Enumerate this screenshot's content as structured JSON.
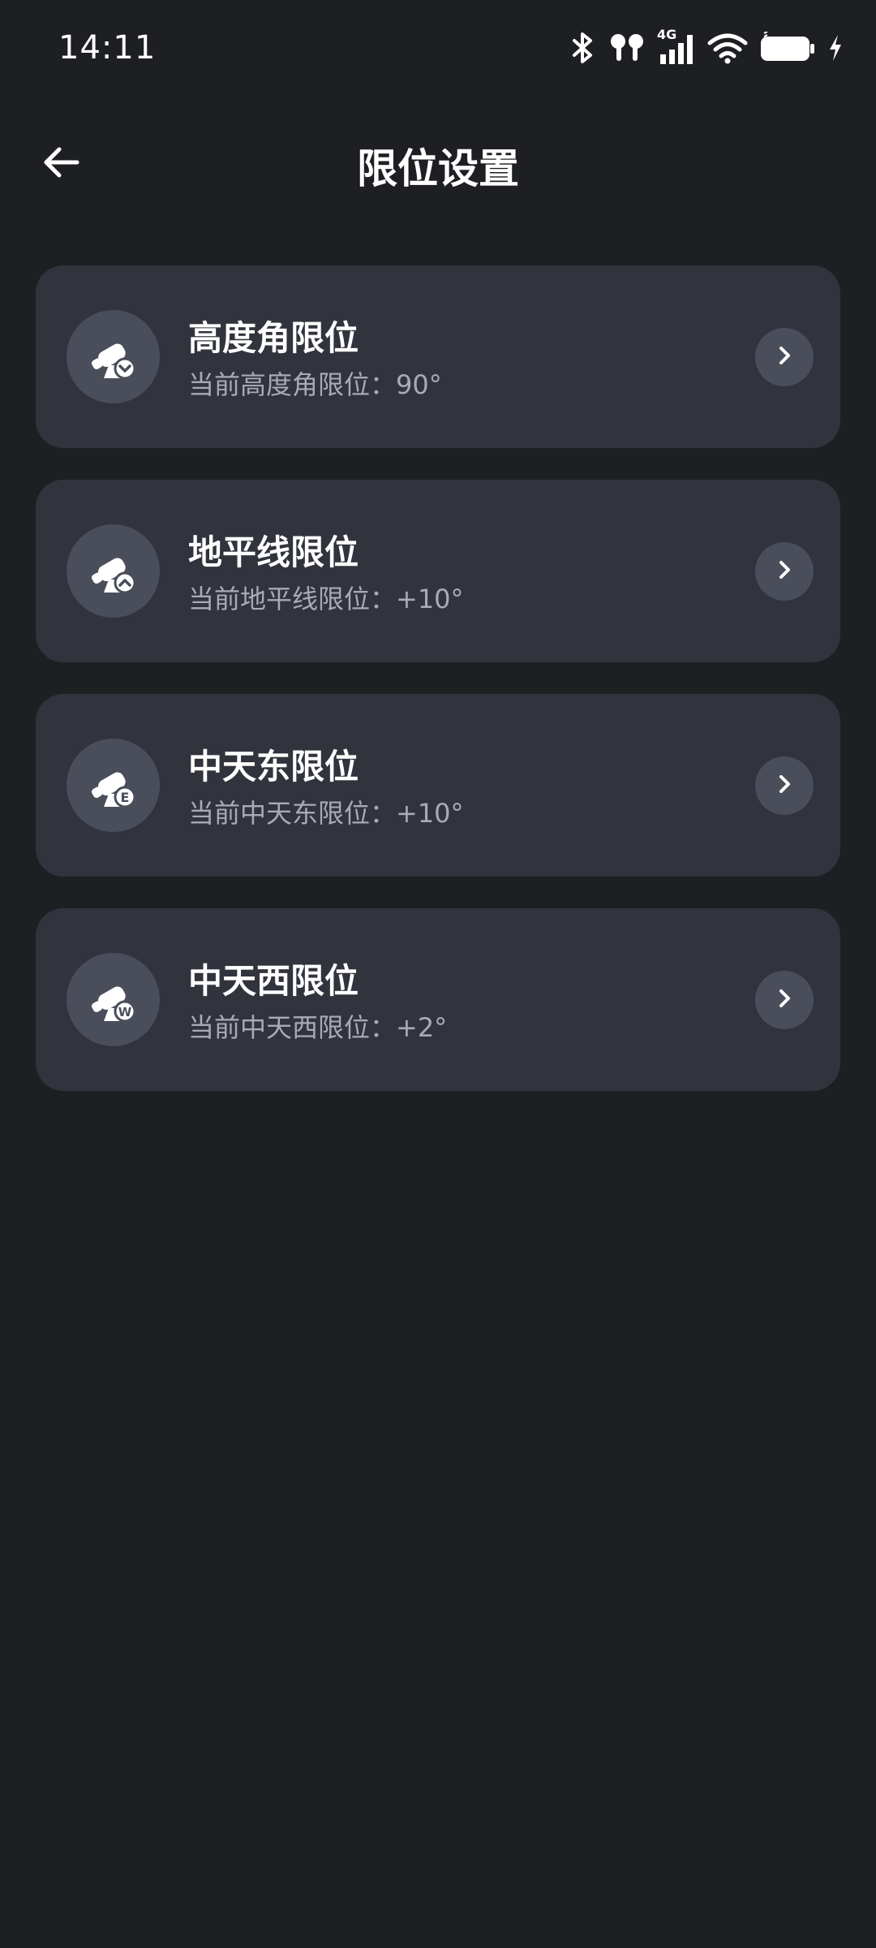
{
  "status_bar": {
    "time": "14:11",
    "icons": [
      "bluetooth-icon",
      "earbuds-icon",
      "signal-4g-icon",
      "wifi-icon",
      "battery-icon",
      "charging-icon"
    ],
    "network_label": "4G"
  },
  "header": {
    "title": "限位设置",
    "back_icon": "arrow-left-icon"
  },
  "cards": [
    {
      "title": "高度角限位",
      "subtitle": "当前高度角限位：90°",
      "badge": "chevron-down",
      "icon": "telescope-altitude-icon"
    },
    {
      "title": "地平线限位",
      "subtitle": "当前地平线限位：+10°",
      "badge": "chevron-up",
      "icon": "telescope-horizon-icon"
    },
    {
      "title": "中天东限位",
      "subtitle": "当前中天东限位：+10°",
      "badge": "E",
      "icon": "telescope-meridian-east-icon"
    },
    {
      "title": "中天西限位",
      "subtitle": "当前中天西限位：+2°",
      "badge": "W",
      "icon": "telescope-meridian-west-icon"
    }
  ],
  "colors": {
    "background": "#1e1f23",
    "card": "#31333d",
    "icon_circle": "#4a4e5b",
    "subtitle": "#a8abb4"
  }
}
